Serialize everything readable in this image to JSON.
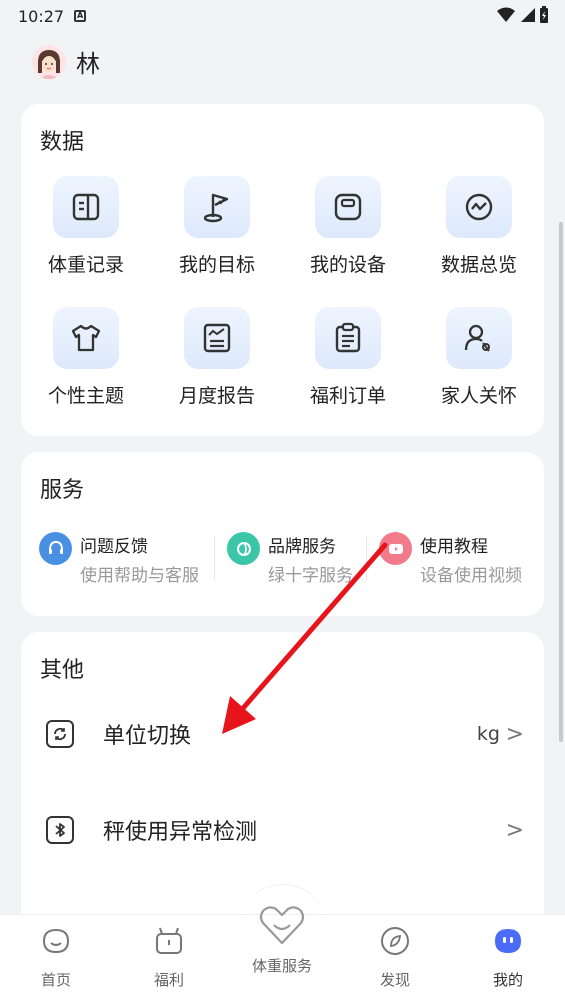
{
  "status": {
    "time": "10:27"
  },
  "profile": {
    "name": "林"
  },
  "data_section": {
    "title": "数据",
    "items": [
      {
        "label": "体重记录",
        "icon": "weight-record-icon"
      },
      {
        "label": "我的目标",
        "icon": "goal-flag-icon"
      },
      {
        "label": "我的设备",
        "icon": "scale-device-icon"
      },
      {
        "label": "数据总览",
        "icon": "data-overview-icon"
      },
      {
        "label": "个性主题",
        "icon": "tshirt-icon"
      },
      {
        "label": "月度报告",
        "icon": "monthly-report-icon"
      },
      {
        "label": "福利订单",
        "icon": "clipboard-icon"
      },
      {
        "label": "家人关怀",
        "icon": "family-care-icon"
      }
    ]
  },
  "service_section": {
    "title": "服务",
    "items": [
      {
        "title": "问题反馈",
        "sub": "使用帮助与客服",
        "color": "#4a90e2"
      },
      {
        "title": "品牌服务",
        "sub": "绿十字服务",
        "color": "#3cc6a8"
      },
      {
        "title": "使用教程",
        "sub": "设备使用视频",
        "color": "#f27a8a"
      }
    ]
  },
  "other_section": {
    "title": "其他",
    "rows": [
      {
        "label": "单位切换",
        "value": "kg",
        "chevron": ">"
      },
      {
        "label": "秤使用异常检测",
        "value": "",
        "chevron": ">"
      }
    ]
  },
  "tabbar": {
    "tabs": [
      {
        "label": "首页"
      },
      {
        "label": "福利"
      },
      {
        "label": "体重服务"
      },
      {
        "label": "发现"
      },
      {
        "label": "我的"
      }
    ],
    "active_color": "#4a6cf7"
  }
}
